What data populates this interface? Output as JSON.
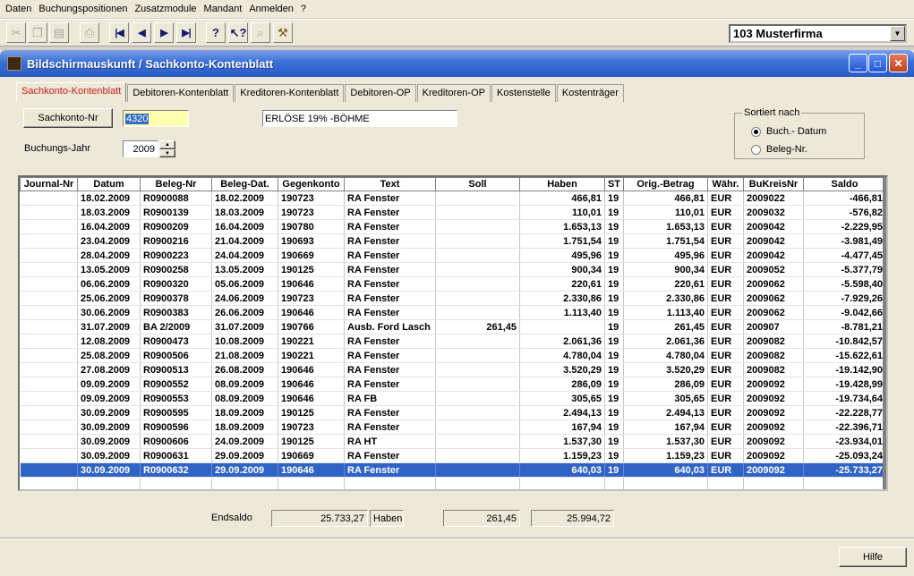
{
  "menu": [
    "Daten",
    "Buchungspositionen",
    "Zusatzmodule",
    "Mandant",
    "Anmelden",
    "?"
  ],
  "toolbar": {
    "icons": [
      "scissors-icon",
      "copy-icon",
      "paste-icon",
      "print-icon",
      "first-record-icon",
      "prev-record-icon",
      "next-record-icon",
      "last-record-icon",
      "help-icon",
      "context-help-icon",
      "search-icon",
      "wrench-icon"
    ]
  },
  "company": {
    "selected": "103 Musterfirma"
  },
  "window": {
    "title": "Bildschirmauskunft / Sachkonto-Kontenblatt"
  },
  "tabs": [
    "Sachkonto-Kontenblatt",
    "Debitoren-Kontenblatt",
    "Kreditoren-Kontenblatt",
    "Debitoren-OP",
    "Kreditoren-OP",
    "Kostenstelle",
    "Kostenträger"
  ],
  "form": {
    "account_button": "Sachkonto-Nr",
    "account_value": "4320",
    "account_desc": "ERLÖSE 19% -BÖHME",
    "year_label": "Buchungs-Jahr",
    "year_value": "2009",
    "sort_title": "Sortiert nach",
    "sort_options": [
      "Buch.- Datum",
      "Beleg-Nr."
    ],
    "sort_selected": 0
  },
  "table": {
    "headers": [
      "Journal-Nr",
      "Datum",
      "Beleg-Nr",
      "Beleg-Dat.",
      "Gegenkonto",
      "Text",
      "Soll",
      "Haben",
      "ST",
      "Orig.-Betrag",
      "Währ.",
      "BuKreisNr",
      "Saldo"
    ],
    "rows": [
      [
        "",
        "18.02.2009",
        "R0900088",
        "18.02.2009",
        "190723",
        "RA Fenster",
        "",
        "466,81",
        "19",
        "466,81",
        "EUR",
        "2009022",
        "-466,81"
      ],
      [
        "",
        "18.03.2009",
        "R0900139",
        "18.03.2009",
        "190723",
        "RA Fenster",
        "",
        "110,01",
        "19",
        "110,01",
        "EUR",
        "2009032",
        "-576,82"
      ],
      [
        "",
        "16.04.2009",
        "R0900209",
        "16.04.2009",
        "190780",
        "RA Fenster",
        "",
        "1.653,13",
        "19",
        "1.653,13",
        "EUR",
        "2009042",
        "-2.229,95"
      ],
      [
        "",
        "23.04.2009",
        "R0900216",
        "21.04.2009",
        "190693",
        "RA Fenster",
        "",
        "1.751,54",
        "19",
        "1.751,54",
        "EUR",
        "2009042",
        "-3.981,49"
      ],
      [
        "",
        "28.04.2009",
        "R0900223",
        "24.04.2009",
        "190669",
        "RA Fenster",
        "",
        "495,96",
        "19",
        "495,96",
        "EUR",
        "2009042",
        "-4.477,45"
      ],
      [
        "",
        "13.05.2009",
        "R0900258",
        "13.05.2009",
        "190125",
        "RA Fenster",
        "",
        "900,34",
        "19",
        "900,34",
        "EUR",
        "2009052",
        "-5.377,79"
      ],
      [
        "",
        "06.06.2009",
        "R0900320",
        "05.06.2009",
        "190646",
        "RA Fenster",
        "",
        "220,61",
        "19",
        "220,61",
        "EUR",
        "2009062",
        "-5.598,40"
      ],
      [
        "",
        "25.06.2009",
        "R0900378",
        "24.06.2009",
        "190723",
        "RA Fenster",
        "",
        "2.330,86",
        "19",
        "2.330,86",
        "EUR",
        "2009062",
        "-7.929,26"
      ],
      [
        "",
        "30.06.2009",
        "R0900383",
        "26.06.2009",
        "190646",
        "RA Fenster",
        "",
        "1.113,40",
        "19",
        "1.113,40",
        "EUR",
        "2009062",
        "-9.042,66"
      ],
      [
        "",
        "31.07.2009",
        "BA 2/2009",
        "31.07.2009",
        "190766",
        "Ausb. Ford Lasch",
        "261,45",
        "",
        "19",
        "261,45",
        "EUR",
        "200907",
        "-8.781,21"
      ],
      [
        "",
        "12.08.2009",
        "R0900473",
        "10.08.2009",
        "190221",
        "RA Fenster",
        "",
        "2.061,36",
        "19",
        "2.061,36",
        "EUR",
        "2009082",
        "-10.842,57"
      ],
      [
        "",
        "25.08.2009",
        "R0900506",
        "21.08.2009",
        "190221",
        "RA Fenster",
        "",
        "4.780,04",
        "19",
        "4.780,04",
        "EUR",
        "2009082",
        "-15.622,61"
      ],
      [
        "",
        "27.08.2009",
        "R0900513",
        "26.08.2009",
        "190646",
        "RA Fenster",
        "",
        "3.520,29",
        "19",
        "3.520,29",
        "EUR",
        "2009082",
        "-19.142,90"
      ],
      [
        "",
        "09.09.2009",
        "R0900552",
        "08.09.2009",
        "190646",
        "RA Fenster",
        "",
        "286,09",
        "19",
        "286,09",
        "EUR",
        "2009092",
        "-19.428,99"
      ],
      [
        "",
        "09.09.2009",
        "R0900553",
        "08.09.2009",
        "190646",
        "RA FB",
        "",
        "305,65",
        "19",
        "305,65",
        "EUR",
        "2009092",
        "-19.734,64"
      ],
      [
        "",
        "30.09.2009",
        "R0900595",
        "18.09.2009",
        "190125",
        "RA Fenster",
        "",
        "2.494,13",
        "19",
        "2.494,13",
        "EUR",
        "2009092",
        "-22.228,77"
      ],
      [
        "",
        "30.09.2009",
        "R0900596",
        "18.09.2009",
        "190723",
        "RA Fenster",
        "",
        "167,94",
        "19",
        "167,94",
        "EUR",
        "2009092",
        "-22.396,71"
      ],
      [
        "",
        "30.09.2009",
        "R0900606",
        "24.09.2009",
        "190125",
        "RA HT",
        "",
        "1.537,30",
        "19",
        "1.537,30",
        "EUR",
        "2009092",
        "-23.934,01"
      ],
      [
        "",
        "30.09.2009",
        "R0900631",
        "29.09.2009",
        "190669",
        "RA Fenster",
        "",
        "1.159,23",
        "19",
        "1.159,23",
        "EUR",
        "2009092",
        "-25.093,24"
      ],
      [
        "",
        "30.09.2009",
        "R0900632",
        "29.09.2009",
        "190646",
        "RA Fenster",
        "",
        "640,03",
        "19",
        "640,03",
        "EUR",
        "2009092",
        "-25.733,27"
      ]
    ],
    "selected_row": 19
  },
  "totals": {
    "label": "Endsaldo",
    "saldo": "25.733,27",
    "side": "Haben",
    "soll": "261,45",
    "haben": "25.994,72"
  },
  "footer": {
    "help_button": "Hilfe"
  }
}
